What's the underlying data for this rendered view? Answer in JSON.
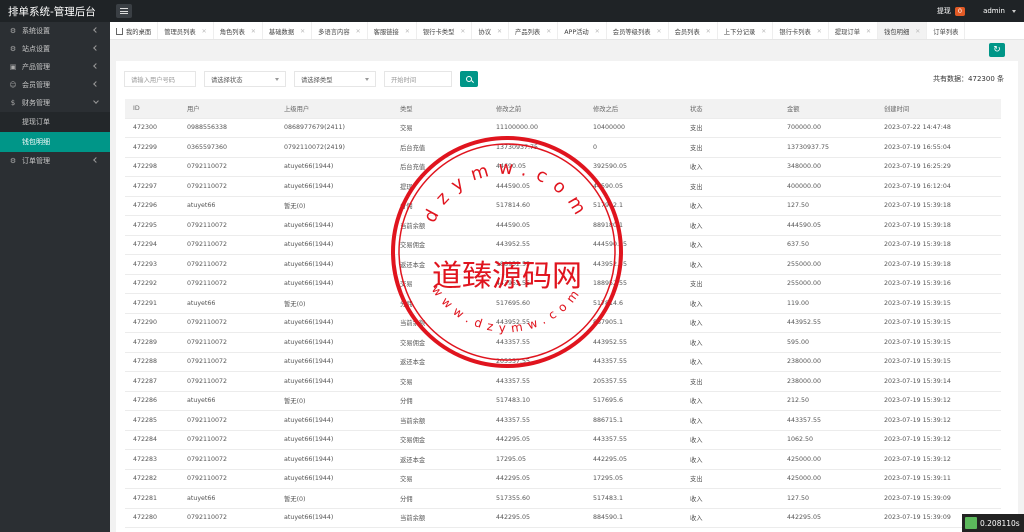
{
  "app_title": "排单系统-管理后台",
  "top_right": {
    "withdraw_label": "提现",
    "withdraw_count": "0",
    "user": "admin"
  },
  "sidebar": {
    "items": [
      {
        "label": "系统设置",
        "icon": "gear-icon"
      },
      {
        "label": "站点设置",
        "icon": "gear-icon"
      },
      {
        "label": "产品管理",
        "icon": "box-icon"
      },
      {
        "label": "会员管理",
        "icon": "user-icon"
      },
      {
        "label": "财务管理",
        "icon": "dollar-icon"
      }
    ],
    "finance_children": [
      "提现订单",
      "钱包明细"
    ],
    "order_item": {
      "label": "订单管理",
      "icon": "gear-icon"
    }
  },
  "tabs": [
    "我的桌面",
    "管理员列表",
    "角色列表",
    "基础数据",
    "多语言内容",
    "客服链接",
    "银行卡类型",
    "协议",
    "产品列表",
    "APP活动",
    "会员等级列表",
    "会员列表",
    "上下分记录",
    "银行卡列表",
    "提现订单",
    "钱包明细",
    "订单列表"
  ],
  "filters": {
    "phone_placeholder": "请输入用户号码",
    "status_select": "请选择状态",
    "type_select": "请选择类型",
    "time_placeholder": "开始时间"
  },
  "total_text": "共有数据：472300 条",
  "table": {
    "headers": [
      "ID",
      "用户",
      "上级用户",
      "类型",
      "修改之前",
      "修改之后",
      "状态",
      "金额",
      "创建时间"
    ],
    "rows": [
      [
        "472300",
        "0988556338",
        "0868977679(2411)",
        "交易",
        "11100000.00",
        "10400000",
        "支出",
        "700000.00",
        "2023-07-22 14:47:48"
      ],
      [
        "472299",
        "0365597360",
        "0792110072(2419)",
        "后台充值",
        "13730937.75",
        "0",
        "支出",
        "13730937.75",
        "2023-07-19 16:55:04"
      ],
      [
        "472298",
        "0792110072",
        "atuyet66(1944)",
        "后台充值",
        "44690.05",
        "392590.05",
        "收入",
        "348000.00",
        "2023-07-19 16:25:29"
      ],
      [
        "472297",
        "0792110072",
        "atuyet66(1944)",
        "提现",
        "444590.05",
        "44590.05",
        "支出",
        "400000.00",
        "2023-07-19 16:12:04"
      ],
      [
        "472296",
        "atuyet66",
        "暂无(0)",
        "分佣",
        "517814.60",
        "517942.1",
        "收入",
        "127.50",
        "2023-07-19 15:39:18"
      ],
      [
        "472295",
        "0792110072",
        "atuyet66(1944)",
        "当前余额",
        "444590.05",
        "889180.1",
        "收入",
        "444590.05",
        "2023-07-19 15:39:18"
      ],
      [
        "472294",
        "0792110072",
        "atuyet66(1944)",
        "交易佣金",
        "443952.55",
        "444590.05",
        "收入",
        "637.50",
        "2023-07-19 15:39:18"
      ],
      [
        "472293",
        "0792110072",
        "atuyet66(1944)",
        "返还本金",
        "188952.55",
        "443952.55",
        "收入",
        "255000.00",
        "2023-07-19 15:39:18"
      ],
      [
        "472292",
        "0792110072",
        "atuyet66(1944)",
        "交易",
        "443952.55",
        "188952.55",
        "支出",
        "255000.00",
        "2023-07-19 15:39:16"
      ],
      [
        "472291",
        "atuyet66",
        "暂无(0)",
        "分佣",
        "517695.60",
        "517814.6",
        "收入",
        "119.00",
        "2023-07-19 15:39:15"
      ],
      [
        "472290",
        "0792110072",
        "atuyet66(1944)",
        "当前余额",
        "443952.55",
        "887905.1",
        "收入",
        "443952.55",
        "2023-07-19 15:39:15"
      ],
      [
        "472289",
        "0792110072",
        "atuyet66(1944)",
        "交易佣金",
        "443357.55",
        "443952.55",
        "收入",
        "595.00",
        "2023-07-19 15:39:15"
      ],
      [
        "472288",
        "0792110072",
        "atuyet66(1944)",
        "返还本金",
        "205357.55",
        "443357.55",
        "收入",
        "238000.00",
        "2023-07-19 15:39:15"
      ],
      [
        "472287",
        "0792110072",
        "atuyet66(1944)",
        "交易",
        "443357.55",
        "205357.55",
        "支出",
        "238000.00",
        "2023-07-19 15:39:14"
      ],
      [
        "472286",
        "atuyet66",
        "暂无(0)",
        "分佣",
        "517483.10",
        "517695.6",
        "收入",
        "212.50",
        "2023-07-19 15:39:12"
      ],
      [
        "472285",
        "0792110072",
        "atuyet66(1944)",
        "当前余额",
        "443357.55",
        "886715.1",
        "收入",
        "443357.55",
        "2023-07-19 15:39:12"
      ],
      [
        "472284",
        "0792110072",
        "atuyet66(1944)",
        "交易佣金",
        "442295.05",
        "443357.55",
        "收入",
        "1062.50",
        "2023-07-19 15:39:12"
      ],
      [
        "472283",
        "0792110072",
        "atuyet66(1944)",
        "返还本金",
        "17295.05",
        "442295.05",
        "收入",
        "425000.00",
        "2023-07-19 15:39:12"
      ],
      [
        "472282",
        "0792110072",
        "atuyet66(1944)",
        "交易",
        "442295.05",
        "17295.05",
        "支出",
        "425000.00",
        "2023-07-19 15:39:11"
      ],
      [
        "472281",
        "atuyet66",
        "暂无(0)",
        "分佣",
        "517355.60",
        "517483.1",
        "收入",
        "127.50",
        "2023-07-19 15:39:09"
      ],
      [
        "472280",
        "0792110072",
        "atuyet66(1944)",
        "当前余额",
        "442295.05",
        "884590.1",
        "收入",
        "442295.05",
        "2023-07-19 15:39:09"
      ]
    ]
  },
  "watermark": {
    "top_text": "dzymw.com",
    "center_text": "道臻源码网",
    "bottom_text": "www.dzymw.com",
    "color": "#e0141e"
  },
  "speed_text": "0.208110s",
  "colors": {
    "accent": "#009688",
    "topbar": "#1f2326",
    "sidebar": "#2b2f33",
    "badge": "#e25a25"
  }
}
